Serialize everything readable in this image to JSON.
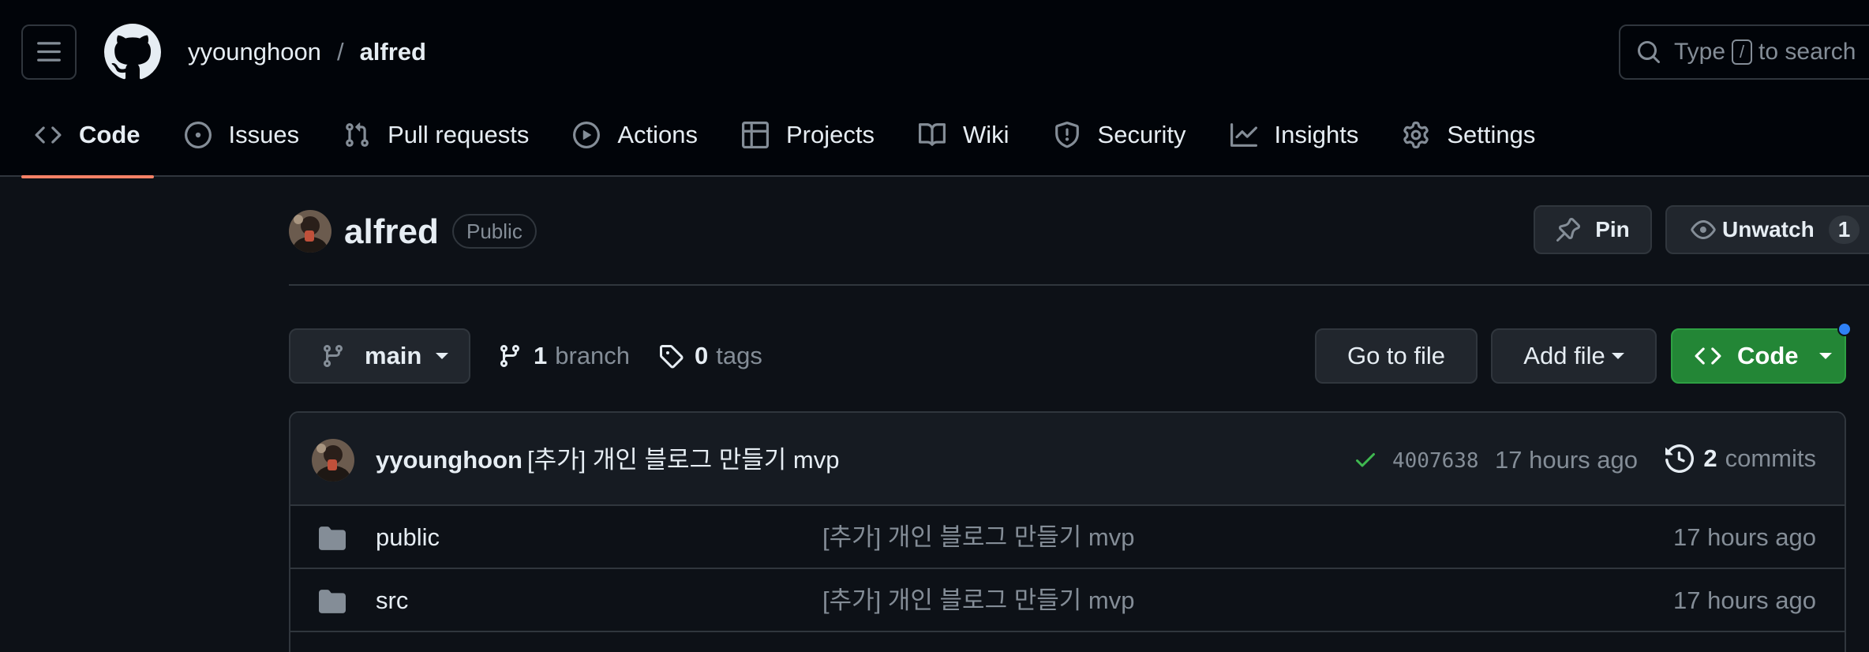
{
  "header": {
    "owner": "yyounghoon",
    "separator": "/",
    "repo": "alfred",
    "search": {
      "prefix": "Type",
      "key": "/",
      "suffix": "to search"
    }
  },
  "tabs": [
    {
      "label": "Code",
      "icon": "code-icon",
      "active": true
    },
    {
      "label": "Issues",
      "icon": "issue-icon"
    },
    {
      "label": "Pull requests",
      "icon": "pull-request-icon"
    },
    {
      "label": "Actions",
      "icon": "play-icon"
    },
    {
      "label": "Projects",
      "icon": "table-icon"
    },
    {
      "label": "Wiki",
      "icon": "book-icon"
    },
    {
      "label": "Security",
      "icon": "shield-icon"
    },
    {
      "label": "Insights",
      "icon": "graph-icon"
    },
    {
      "label": "Settings",
      "icon": "gear-icon"
    }
  ],
  "repo_header": {
    "name": "alfred",
    "visibility": "Public",
    "pin_label": "Pin",
    "watch_label": "Unwatch",
    "watch_count": "1"
  },
  "file_nav": {
    "branch": "main",
    "branch_count": "1",
    "branch_label": "branch",
    "tag_count": "0",
    "tag_label": "tags",
    "go_to_file": "Go to file",
    "add_file": "Add file",
    "code_label": "Code"
  },
  "latest_commit": {
    "author": "yyounghoon",
    "message": "[추가] 개인 블로그 만들기 mvp",
    "sha": "4007638",
    "time": "17 hours ago",
    "commit_count": "2",
    "commit_label": "commits"
  },
  "files": [
    {
      "name": "public",
      "message": "[추가] 개인 블로그 만들기 mvp",
      "time": "17 hours ago"
    },
    {
      "name": "src",
      "message": "[추가] 개인 블로그 만들기 mvp",
      "time": "17 hours ago"
    }
  ],
  "colors": {
    "background": "#0d1117",
    "header_bg": "#010409",
    "accent_underline": "#f78166",
    "code_button": "#238636",
    "success_check": "#3fb950",
    "notification_dot": "#2f81f7"
  }
}
